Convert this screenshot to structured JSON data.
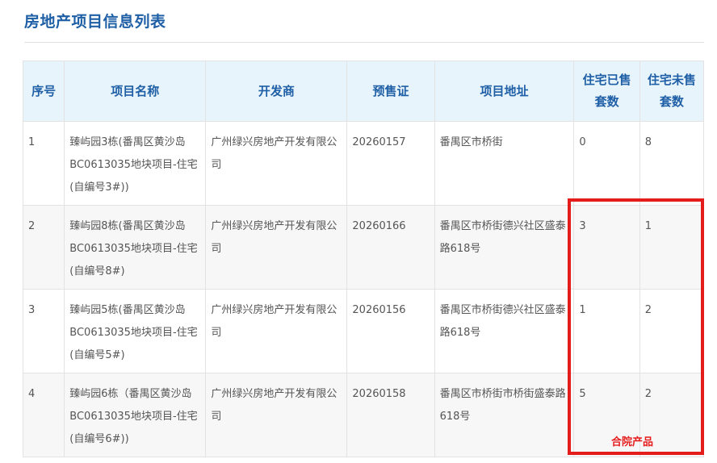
{
  "page_title": "房地产项目信息列表",
  "columns": [
    {
      "label": "序号"
    },
    {
      "label": "项目名称"
    },
    {
      "label": "开发商"
    },
    {
      "label": "预售证"
    },
    {
      "label": "项目地址"
    },
    {
      "label": "住宅已售套数"
    },
    {
      "label": "住宅未售套数"
    }
  ],
  "rows": [
    {
      "no": "1",
      "name": "臻屿园3栋(番禺区黄沙岛BC0613035地块项目-住宅(自编号3#))",
      "developer": "广州绿兴房地产开发有限公司",
      "permit": "20260157",
      "address": "番禺区市桥街",
      "sold": "0",
      "unsold": "8"
    },
    {
      "no": "2",
      "name": "臻屿园8栋(番禺区黄沙岛BC0613035地块项目-住宅(自编号8#)",
      "developer": "广州绿兴房地产开发有限公司",
      "permit": "20260166",
      "address": "番禺区市桥街德兴社区盛泰路618号",
      "sold": "3",
      "unsold": "1"
    },
    {
      "no": "3",
      "name": "臻屿园5栋(番禺区黄沙岛BC0613035地块项目-住宅(自编号5#)",
      "developer": "广州绿兴房地产开发有限公司",
      "permit": "20260156",
      "address": "番禺区市桥街德兴社区盛泰路618号",
      "sold": "1",
      "unsold": "2"
    },
    {
      "no": "4",
      "name": "臻屿园6栋（番禺区黄沙岛BC0613035地块项目-住宅(自编号6#))",
      "developer": "广州绿兴房地产开发有限公司",
      "permit": "20260158",
      "address": "番禺区市桥街市桥街盛泰路618号",
      "sold": "5",
      "unsold": "2"
    }
  ],
  "annotation": {
    "note": "合院产品",
    "color": "#e51c1c"
  },
  "colors": {
    "title": "#1f5fa6",
    "header_bg": "#e8f4fc",
    "alt_row_bg": "#f7f7f7"
  }
}
